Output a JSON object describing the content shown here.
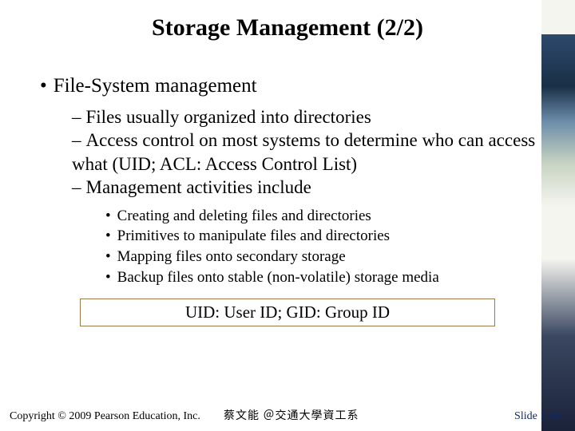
{
  "title": "Storage Management (2/2)",
  "bullets": {
    "l1": "File-System management",
    "l2a": "Files usually organized into directories",
    "l2b": "Access control on most systems to determine who can access what (UID; ACL: Access Control List)",
    "l2c": "Management activities include",
    "l3a": "Creating and deleting files and directories",
    "l3b": "Primitives to manipulate files and directories",
    "l3c": "Mapping files onto secondary storage",
    "l3d": "Backup files onto stable (non-volatile) storage media"
  },
  "box": "UID: User ID;  GID: Group ID",
  "footer": {
    "copyright": "Copyright © 2009 Pearson Education, Inc.",
    "author": "蔡文能 ＠交通大學資工系",
    "slide": "Slide 1-40"
  }
}
